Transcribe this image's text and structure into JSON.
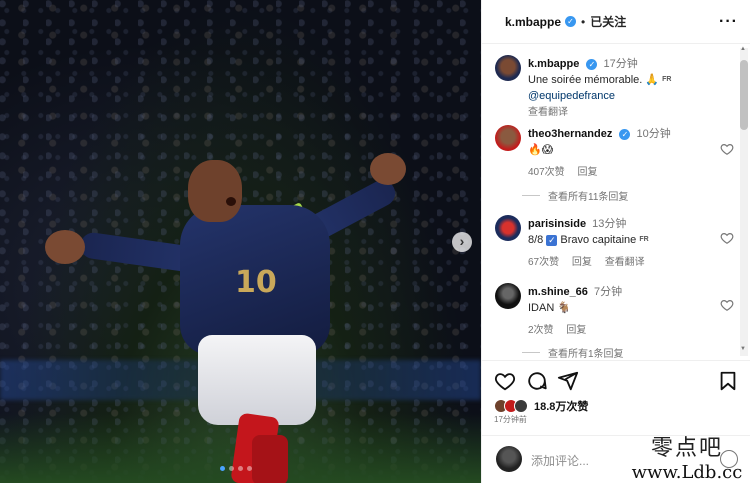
{
  "post": {
    "username": "k.mbappe",
    "separator": "•",
    "follow_status": "已关注",
    "more": "···",
    "carousel_next": "›"
  },
  "caption": {
    "username": "k.mbappe",
    "time": "17分钟",
    "text": "Une soirée mémorable. 🙏",
    "lang": "FR",
    "mention": "@equipedefrance",
    "translate": "查看翻译"
  },
  "comments": [
    {
      "username": "theo3hernandez",
      "time": "10分钟",
      "text": "🔥😱",
      "likes": "407次赞",
      "reply": "回复",
      "view_replies": "查看所有11条回复"
    },
    {
      "username": "parisinside",
      "time": "13分钟",
      "text_prefix": "8/8",
      "text_check": "✓",
      "text": "Bravo capitaine",
      "lang": "FR",
      "likes": "67次赞",
      "reply": "回复",
      "translate": "查看翻译"
    },
    {
      "username": "m.shine_66",
      "time": "7分钟",
      "text": "IDAN 🐐",
      "likes": "2次赞",
      "reply": "回复",
      "view_replies": "查看所有1条回复"
    }
  ],
  "stats": {
    "likes": "18.8万次赞",
    "ago": "17分钟前"
  },
  "composer": {
    "placeholder": "添加评论..."
  },
  "watermark": {
    "top": "零点吧",
    "bottom": "www.Ldb.cc"
  },
  "colors": {
    "verified": "#3897f0",
    "jersey": "#24346b",
    "armband": "#a6d94a"
  }
}
